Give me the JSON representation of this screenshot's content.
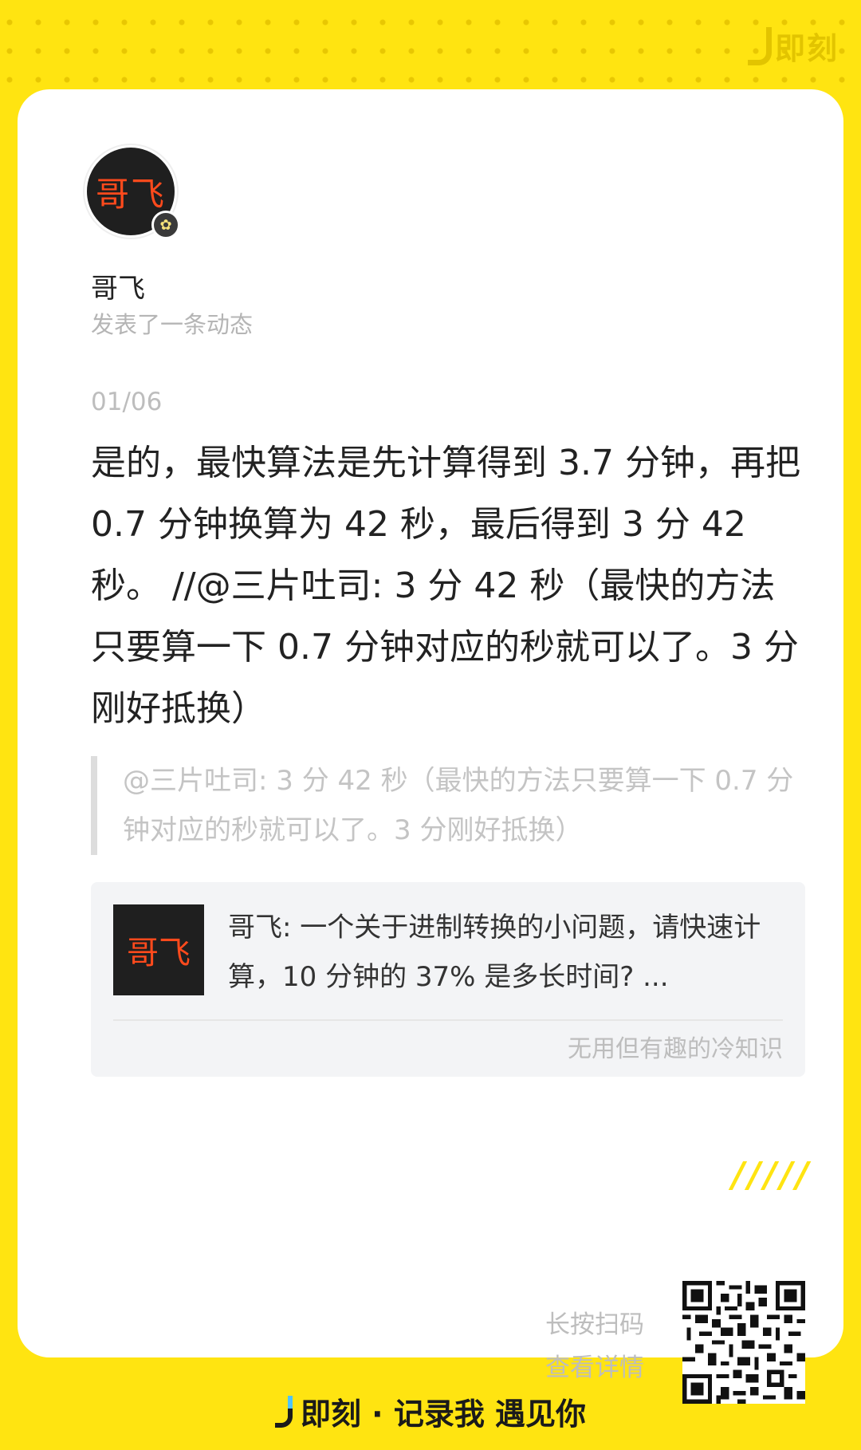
{
  "brand": {
    "name": "即刻"
  },
  "post": {
    "avatar_text": "哥飞",
    "username": "哥飞",
    "action": "发表了一条动态",
    "date": "01/06",
    "content": "是的，最快算法是先计算得到 3.7 分钟，再把 0.7 分钟换算为 42 秒，最后得到 3 分 42 秒。 //@三片吐司: 3 分 42 秒（最快的方法只要算一下 0.7 分钟对应的秒就可以了。3 分刚好抵换）",
    "quote": "@三片吐司: 3 分 42 秒（最快的方法只要算一下 0.7 分钟对应的秒就可以了。3 分刚好抵换）"
  },
  "reference": {
    "thumb_text": "哥飞",
    "text": "哥飞: 一个关于进制转换的小问题，请快速计算，10 分钟的 37% 是多长时间? ...",
    "topic": "无用但有趣的冷知识"
  },
  "decoration": {
    "slashes": "/////"
  },
  "share": {
    "line1": "长按扫码",
    "line2": "查看详情"
  },
  "footer": {
    "slogan": "即刻 · 记录我 遇见你"
  },
  "colors": {
    "background": "#FFE411",
    "card": "#FFFFFF",
    "accent_red": "#FF4A1C"
  }
}
